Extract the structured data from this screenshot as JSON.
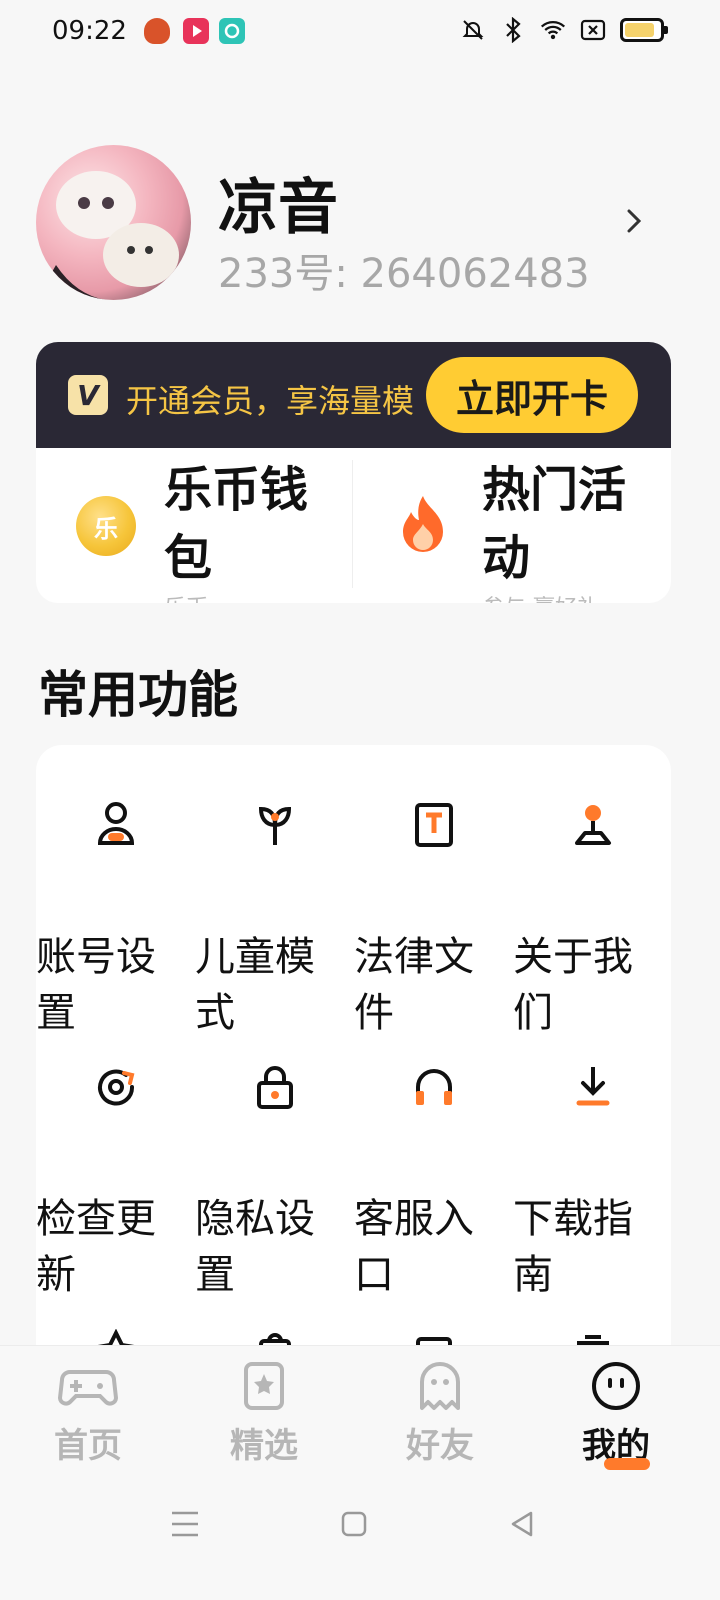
{
  "status": {
    "time": "09:22",
    "battery_level": 0.85,
    "icons": [
      "jack-o-lantern-app-icon",
      "video-app-icon",
      "chat-app-icon",
      "dnd-bell-icon",
      "bluetooth-icon",
      "wifi-icon",
      "sim-off-icon",
      "battery-icon"
    ]
  },
  "profile": {
    "name": "凉音",
    "id_text": "233号: 264062483"
  },
  "vip": {
    "text": "开通会员，享海量模",
    "button": "立即开卡",
    "logo": "V"
  },
  "wallet": {
    "coin_glyph": "乐",
    "title": "乐币钱包",
    "sub": "乐币",
    "activity_title": "热门活动",
    "activity_sub": "参与 赢好礼"
  },
  "section": {
    "title": "常用功能"
  },
  "functions": [
    {
      "label": "账号设置",
      "icon": "user-icon"
    },
    {
      "label": "儿童模式",
      "icon": "sprout-icon"
    },
    {
      "label": "法律文件",
      "icon": "document-t-icon"
    },
    {
      "label": "关于我们",
      "icon": "pin-person-icon"
    },
    {
      "label": "检查更新",
      "icon": "refresh-icon"
    },
    {
      "label": "隐私设置",
      "icon": "lock-icon"
    },
    {
      "label": "客服入口",
      "icon": "headphones-icon"
    },
    {
      "label": "下载指南",
      "icon": "download-icon"
    }
  ],
  "nav": [
    {
      "label": "首页",
      "icon": "gamepad-icon"
    },
    {
      "label": "精选",
      "icon": "star-bookmark-icon"
    },
    {
      "label": "好友",
      "icon": "ghost-icon"
    },
    {
      "label": "我的",
      "icon": "smile-face-icon"
    }
  ],
  "colors": {
    "accent": "#ff7a2b",
    "vip_bg": "#2a2835",
    "vip_gold": "#f5c545",
    "vip_button": "#ffcc33"
  }
}
